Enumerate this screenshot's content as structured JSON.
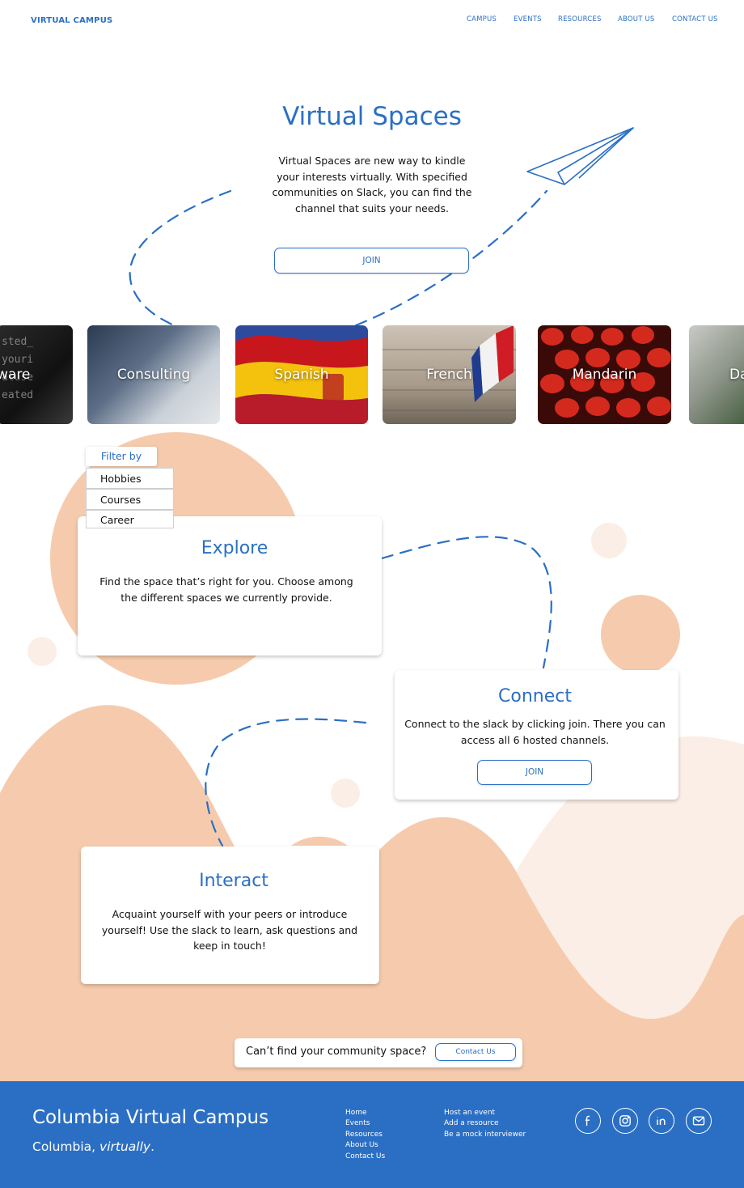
{
  "header": {
    "logo": "VIRTUAL CAMPUS",
    "nav": [
      "CAMPUS",
      "EVENTS",
      "RESOURCES",
      "ABOUT US",
      "CONTACT US"
    ]
  },
  "hero": {
    "title": "Virtual Spaces",
    "description": "Virtual Spaces are new way to kindle your interests virtually. With specified communities on Slack, you can find the channel that suits your needs.",
    "join_label": "JOIN"
  },
  "spaces": [
    "ware",
    "Consulting",
    "Spanish",
    "French",
    "Mandarin",
    "Da"
  ],
  "filter": {
    "label": "Filter by",
    "options": [
      "Hobbies",
      "Courses",
      "Career"
    ]
  },
  "explore": {
    "title": "Explore",
    "text": "Find the space that’s right for you. Choose among the different spaces we currently provide."
  },
  "connect": {
    "title": "Connect",
    "text": "Connect to the slack by clicking join. There you can access all 6 hosted channels.",
    "join_label": "JOIN"
  },
  "interact": {
    "title": "Interact",
    "text": "Acquaint yourself with your peers or introduce yourself! Use the slack to learn, ask questions and keep in touch!"
  },
  "cta": {
    "text": "Can’t find your community space?",
    "button": "Contact Us"
  },
  "footer": {
    "title": "Columbia Virtual Campus",
    "subtitle_plain": "Columbia, ",
    "subtitle_italic": "virtually",
    "subtitle_end": ".",
    "links_col1": [
      "Home",
      "Events",
      "Resources",
      "About Us",
      "Contact Us"
    ],
    "links_col2": [
      "Host an event",
      "Add a resource",
      "Be a mock interviewer"
    ],
    "social": [
      "facebook-icon",
      "instagram-icon",
      "linkedin-icon",
      "mail-icon"
    ]
  },
  "colors": {
    "accent": "#2b6fc5",
    "peach": "#f6cbad",
    "peach_light": "#fbeee6",
    "footer_bg": "#2b6fc5"
  }
}
